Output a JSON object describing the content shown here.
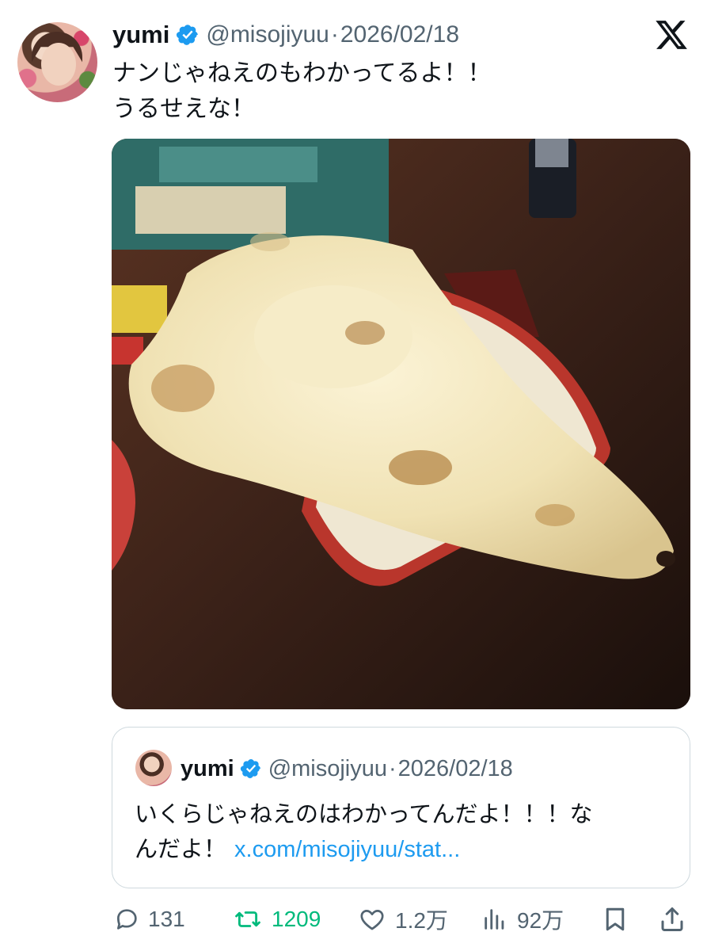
{
  "post": {
    "author_name": "yumi",
    "handle": "@misojiyuu",
    "separator": "·",
    "date": "2026/02/18",
    "text_lines": [
      "ナンじゃねえのもわかってるよ！！",
      "うるせえな！"
    ]
  },
  "quoted_post": {
    "author_name": "yumi",
    "handle": "@misojiyuu",
    "separator": "·",
    "date": "2026/02/18",
    "text_lines": [
      "いくらじゃねえのはわかってんだよ！！！な",
      "んだよ！"
    ],
    "link": "x.com/misojiyuu/stat..."
  },
  "actions": {
    "replies": "131",
    "reposts": "1209",
    "likes": "1.2万",
    "views": "92万"
  },
  "icons": {
    "verified": "verified-badge-icon",
    "brand": "x-logo-icon",
    "reply": "reply-icon",
    "repost": "repost-icon",
    "like": "heart-icon",
    "views": "views-icon",
    "bookmark": "bookmark-icon",
    "share": "share-icon"
  },
  "colors": {
    "verified": "#1d9bf0",
    "link": "#1d9bf0",
    "repost_active": "#00ba7c",
    "secondary_text": "#536471"
  }
}
